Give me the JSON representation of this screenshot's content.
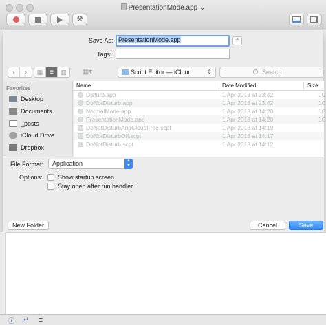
{
  "window": {
    "title": "PresentationMode.app",
    "title_chevron": "⌄"
  },
  "toolbar": {
    "record": "record-button",
    "stop": "stop-button",
    "run": "run-button",
    "compile_glyph": "⚒"
  },
  "save_sheet": {
    "save_as_label": "Save As:",
    "save_as_value": "PresentationMode.app",
    "expand_glyph": "⌃",
    "tags_label": "Tags:",
    "tags_value": "",
    "back_glyph": "‹",
    "forward_glyph": "›",
    "location": "Script Editor — iCloud",
    "location_chevron": "⌃",
    "search_placeholder": "Search",
    "sidebar": {
      "header": "Favorites",
      "items": [
        {
          "label": "Desktop",
          "icon": "desktop-icon"
        },
        {
          "label": "Documents",
          "icon": "documents-icon"
        },
        {
          "label": "_posts",
          "icon": "folder-icon"
        },
        {
          "label": "iCloud Drive",
          "icon": "icloud-icon"
        },
        {
          "label": "Dropbox",
          "icon": "dropbox-icon"
        }
      ]
    },
    "columns": {
      "name": "Name",
      "date": "Date Modified",
      "size": "Size"
    },
    "files": [
      {
        "name": "Disturb.app",
        "date": "1 Apr 2018 at 23:42",
        "size": "1C",
        "kind": "app"
      },
      {
        "name": "DoNotDisturb.app",
        "date": "1 Apr 2018 at 23:42",
        "size": "1C",
        "kind": "app"
      },
      {
        "name": "NormalMode.app",
        "date": "1 Apr 2018 at 14:20",
        "size": "1C",
        "kind": "app"
      },
      {
        "name": "PresentationMode.app",
        "date": "1 Apr 2018 at 14:20",
        "size": "1C",
        "kind": "app"
      },
      {
        "name": "DoNotDisturbAndCloudFree.scpt",
        "date": "1 Apr 2018 at 14:19",
        "size": "",
        "kind": "script"
      },
      {
        "name": "DoNotDisturbOff.scpt",
        "date": "1 Apr 2018 at 14:17",
        "size": "",
        "kind": "script"
      },
      {
        "name": "DoNotDisturb.scpt",
        "date": "1 Apr 2018 at 14:12",
        "size": "",
        "kind": "script"
      }
    ],
    "file_format_label": "File Format:",
    "file_format_value": "Application",
    "options_label": "Options:",
    "option_startup": "Show startup screen",
    "option_stay_open": "Stay open after run handler",
    "new_folder": "New Folder",
    "cancel": "Cancel",
    "save": "Save"
  },
  "status": {
    "info_glyph": "ⓘ",
    "return_glyph": "↵",
    "list_glyph": "≣"
  },
  "colors": {
    "accent": "#3e88f4",
    "selection": "#b3d1f7"
  }
}
